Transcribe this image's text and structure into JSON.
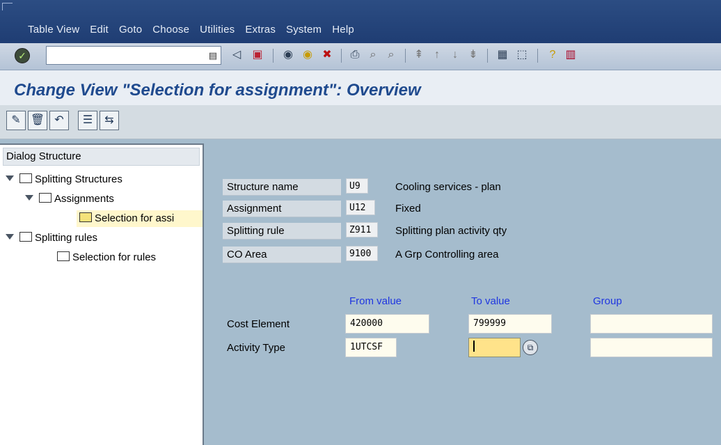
{
  "menu": {
    "items": [
      "Table View",
      "Edit",
      "Goto",
      "Choose",
      "Utilities",
      "Extras",
      "System",
      "Help"
    ]
  },
  "toolbar": {
    "command_value": "",
    "icons": [
      "back-icon",
      "save-icon",
      "exit-icon",
      "cancel-icon",
      "print-icon",
      "find-icon",
      "find-next-icon",
      "first-page-icon",
      "previous-page-icon",
      "next-page-icon",
      "last-page-icon",
      "create-session-icon",
      "shortcut-icon",
      "help-icon",
      "layout-icon"
    ]
  },
  "title": "Change View \"Selection for assignment\": Overview",
  "app_toolbar": {
    "icons": [
      "display-change-icon",
      "delete-icon",
      "undo-icon",
      "select-all-icon",
      "transport-icon"
    ]
  },
  "dialog_structure": {
    "header": "Dialog Structure",
    "items": [
      {
        "label": "Splitting Structures",
        "expanded": true,
        "level": 0
      },
      {
        "label": "Assignments",
        "expanded": true,
        "level": 1
      },
      {
        "label": "Selection for assi",
        "selected": true,
        "level": 2
      },
      {
        "label": "Splitting rules",
        "expanded": true,
        "level": 0
      },
      {
        "label": "Selection for rules",
        "level": 1
      }
    ]
  },
  "header_fields": [
    {
      "label": "Structure name",
      "code": "U9",
      "description": "Cooling services - plan"
    },
    {
      "label": "Assignment",
      "code": "U12",
      "description": "Fixed"
    },
    {
      "label": "Splitting rule",
      "code": "Z911",
      "description": "Splitting plan activity qty"
    },
    {
      "label": "CO Area",
      "code": "9100",
      "description": "A Grp Controlling area"
    }
  ],
  "columns": {
    "from": "From value",
    "to": "To value",
    "group": "Group"
  },
  "rows": [
    {
      "label": "Cost Element",
      "from": "420000",
      "to": "799999",
      "group": ""
    },
    {
      "label": "Activity Type",
      "from": "1UTCSF",
      "to": "",
      "group": ""
    }
  ],
  "colors": {
    "menu_bg": "#1f3d73",
    "content_bg": "#a5bccd",
    "title_color": "#1f4a8e",
    "column_head": "#1f36e0",
    "focus_field": "#ffe38a"
  }
}
